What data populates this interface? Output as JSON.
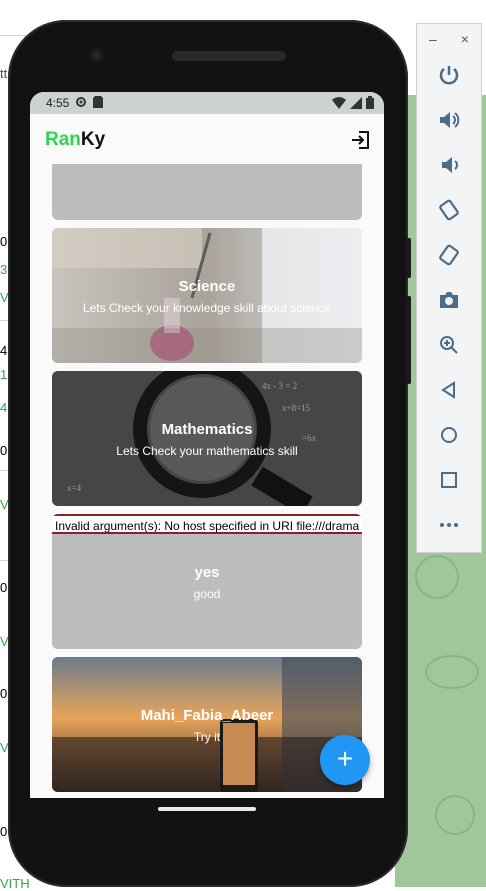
{
  "status_bar": {
    "time": "4:55"
  },
  "app": {
    "brand_part1": "Ran",
    "brand_part2": "Ky",
    "brand_color_1": "#2bd64a",
    "brand_color_2": "#111111"
  },
  "cards": [
    {
      "title": "",
      "subtitle": ""
    },
    {
      "title": "Science",
      "subtitle": "Lets Check your knowledge skill about science"
    },
    {
      "title": "Mathematics",
      "subtitle": "Lets Check your mathematics skill"
    },
    {
      "title": "yes",
      "subtitle": "good",
      "error": "Invalid argument(s): No host specified in URI file:///drama"
    },
    {
      "title": "Mahi_Fabia_Abeer",
      "subtitle": "Try it"
    }
  ],
  "fab": {
    "label": "+"
  },
  "emulator_tools": {
    "minimize": "–",
    "close": "×"
  }
}
